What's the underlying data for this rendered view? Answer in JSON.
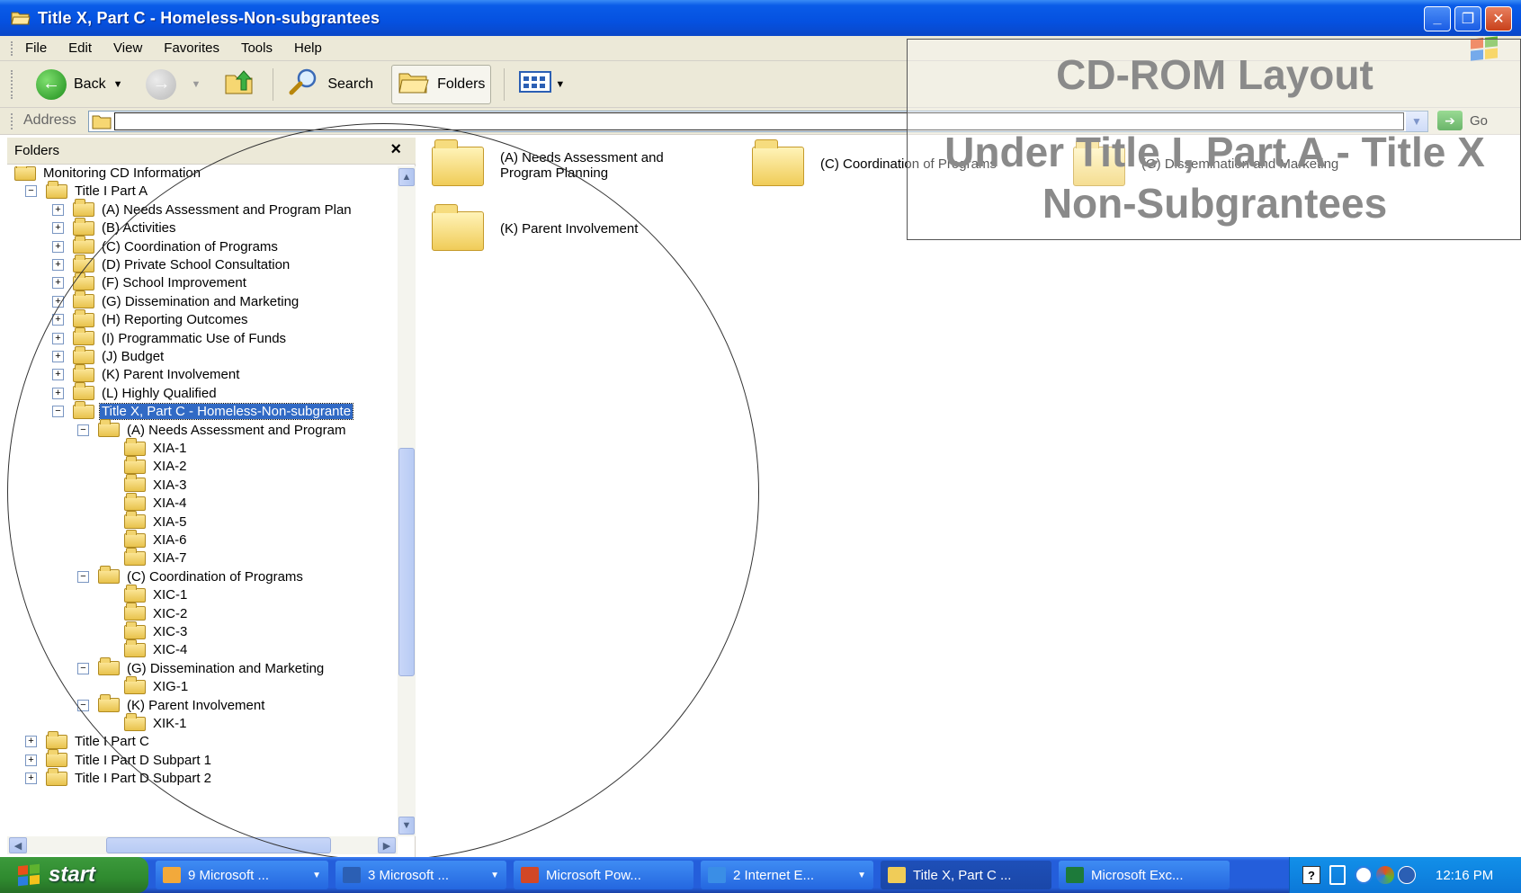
{
  "window": {
    "title": "Title X, Part C - Homeless-Non-subgrantees"
  },
  "menu": [
    "File",
    "Edit",
    "View",
    "Favorites",
    "Tools",
    "Help"
  ],
  "toolbar": {
    "back": "Back",
    "search": "Search",
    "folders": "Folders"
  },
  "address": {
    "label": "Address",
    "value": "",
    "go": "Go"
  },
  "folders_pane": {
    "title": "Folders",
    "close_glyph": "×",
    "tree": [
      {
        "label": "Monitoring CD Information",
        "level": 0,
        "expander": "",
        "selected": false
      },
      {
        "label": "Title I Part A",
        "level": 1,
        "expander": "−",
        "selected": false
      },
      {
        "label": "(A) Needs Assessment and Program Plan",
        "level": 2,
        "expander": "+",
        "selected": false
      },
      {
        "label": "(B) Activities",
        "level": 2,
        "expander": "+",
        "selected": false
      },
      {
        "label": "(C) Coordination of Programs",
        "level": 2,
        "expander": "+",
        "selected": false
      },
      {
        "label": "(D) Private School Consultation",
        "level": 2,
        "expander": "+",
        "selected": false
      },
      {
        "label": "(F) School Improvement",
        "level": 2,
        "expander": "+",
        "selected": false
      },
      {
        "label": "(G) Dissemination and Marketing",
        "level": 2,
        "expander": "+",
        "selected": false
      },
      {
        "label": "(H) Reporting Outcomes",
        "level": 2,
        "expander": "+",
        "selected": false
      },
      {
        "label": "(I) Programmatic Use of Funds",
        "level": 2,
        "expander": "+",
        "selected": false
      },
      {
        "label": "(J) Budget",
        "level": 2,
        "expander": "+",
        "selected": false
      },
      {
        "label": "(K) Parent Involvement",
        "level": 2,
        "expander": "+",
        "selected": false
      },
      {
        "label": "(L) Highly Qualified",
        "level": 2,
        "expander": "+",
        "selected": false
      },
      {
        "label": "Title X, Part C - Homeless-Non-subgrante",
        "level": 2,
        "expander": "−",
        "selected": true
      },
      {
        "label": "(A) Needs Assessment and Program",
        "level": 3,
        "expander": "−",
        "selected": false
      },
      {
        "label": "XIA-1",
        "level": 4,
        "expander": "",
        "selected": false
      },
      {
        "label": "XIA-2",
        "level": 4,
        "expander": "",
        "selected": false
      },
      {
        "label": "XIA-3",
        "level": 4,
        "expander": "",
        "selected": false
      },
      {
        "label": "XIA-4",
        "level": 4,
        "expander": "",
        "selected": false
      },
      {
        "label": "XIA-5",
        "level": 4,
        "expander": "",
        "selected": false
      },
      {
        "label": "XIA-6",
        "level": 4,
        "expander": "",
        "selected": false
      },
      {
        "label": "XIA-7",
        "level": 4,
        "expander": "",
        "selected": false
      },
      {
        "label": "(C) Coordination of Programs",
        "level": 3,
        "expander": "−",
        "selected": false
      },
      {
        "label": "XIC-1",
        "level": 4,
        "expander": "",
        "selected": false
      },
      {
        "label": "XIC-2",
        "level": 4,
        "expander": "",
        "selected": false
      },
      {
        "label": "XIC-3",
        "level": 4,
        "expander": "",
        "selected": false
      },
      {
        "label": "XIC-4",
        "level": 4,
        "expander": "",
        "selected": false
      },
      {
        "label": "(G) Dissemination and Marketing",
        "level": 3,
        "expander": "−",
        "selected": false
      },
      {
        "label": "XIG-1",
        "level": 4,
        "expander": "",
        "selected": false
      },
      {
        "label": "(K) Parent Involvement",
        "level": 3,
        "expander": "−",
        "selected": false
      },
      {
        "label": "XIK-1",
        "level": 4,
        "expander": "",
        "selected": false
      },
      {
        "label": "Title I Part C",
        "level": 1,
        "expander": "+",
        "selected": false
      },
      {
        "label": "Title I Part D Subpart 1",
        "level": 1,
        "expander": "+",
        "selected": false
      },
      {
        "label": "Title I Part D Subpart 2",
        "level": 1,
        "expander": "+",
        "selected": false
      }
    ]
  },
  "content": {
    "items": [
      {
        "label": "(A) Needs Assessment and Program Planning"
      },
      {
        "label": "(C) Coordination of Programs"
      },
      {
        "label": "(G) Dissemination and Marketing"
      },
      {
        "label": "(K) Parent Involvement"
      }
    ]
  },
  "overlay": {
    "line1": "CD-ROM Layout",
    "line2": "Under Title I, Part A - Title X",
    "line3": "Non-Subgrantees"
  },
  "taskbar": {
    "start": "start",
    "tasks": [
      {
        "label": "9 Microsoft ...",
        "icon_color": "#f2a93b",
        "has_caret": true,
        "active": false
      },
      {
        "label": "3 Microsoft ...",
        "icon_color": "#2b5fb4",
        "has_caret": true,
        "active": false
      },
      {
        "label": "Microsoft Pow...",
        "icon_color": "#d24726",
        "has_caret": false,
        "active": false
      },
      {
        "label": "2 Internet E...",
        "icon_color": "#3a8ee6",
        "has_caret": true,
        "active": false
      },
      {
        "label": "Title X, Part C ...",
        "icon_color": "#f0cc58",
        "has_caret": false,
        "active": true
      },
      {
        "label": "Microsoft Exc...",
        "icon_color": "#1d7a3a",
        "has_caret": false,
        "active": false
      }
    ],
    "clock": "12:16 PM"
  },
  "colors": {
    "selection": "#316ac5",
    "titlebar": "#0551e0",
    "taskbar": "#245edb",
    "overlay_text": "#8a8a8a"
  }
}
